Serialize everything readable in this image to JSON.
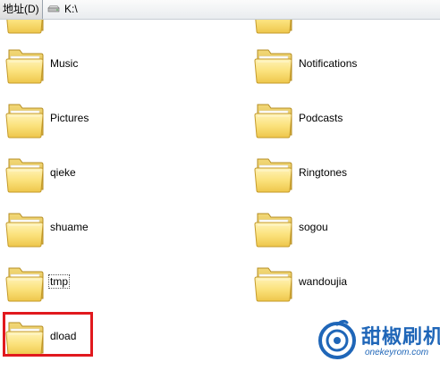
{
  "address_bar": {
    "label": "地址(D)",
    "path": "K:\\"
  },
  "items": [
    {
      "name": "Music"
    },
    {
      "name": "Notifications"
    },
    {
      "name": "Pictures"
    },
    {
      "name": "Podcasts"
    },
    {
      "name": "qieke"
    },
    {
      "name": "Ringtones"
    },
    {
      "name": "shuame"
    },
    {
      "name": "sogou"
    },
    {
      "name": "tmp"
    },
    {
      "name": "wandoujia"
    },
    {
      "name": "dload"
    }
  ],
  "highlight_color": "#e1191e",
  "watermark": {
    "name": "甜椒刷机",
    "url": "onekeyrom.com",
    "color": "#1f66b8"
  },
  "icons": {
    "drive": "drive-icon",
    "folder": "folder-icon"
  }
}
